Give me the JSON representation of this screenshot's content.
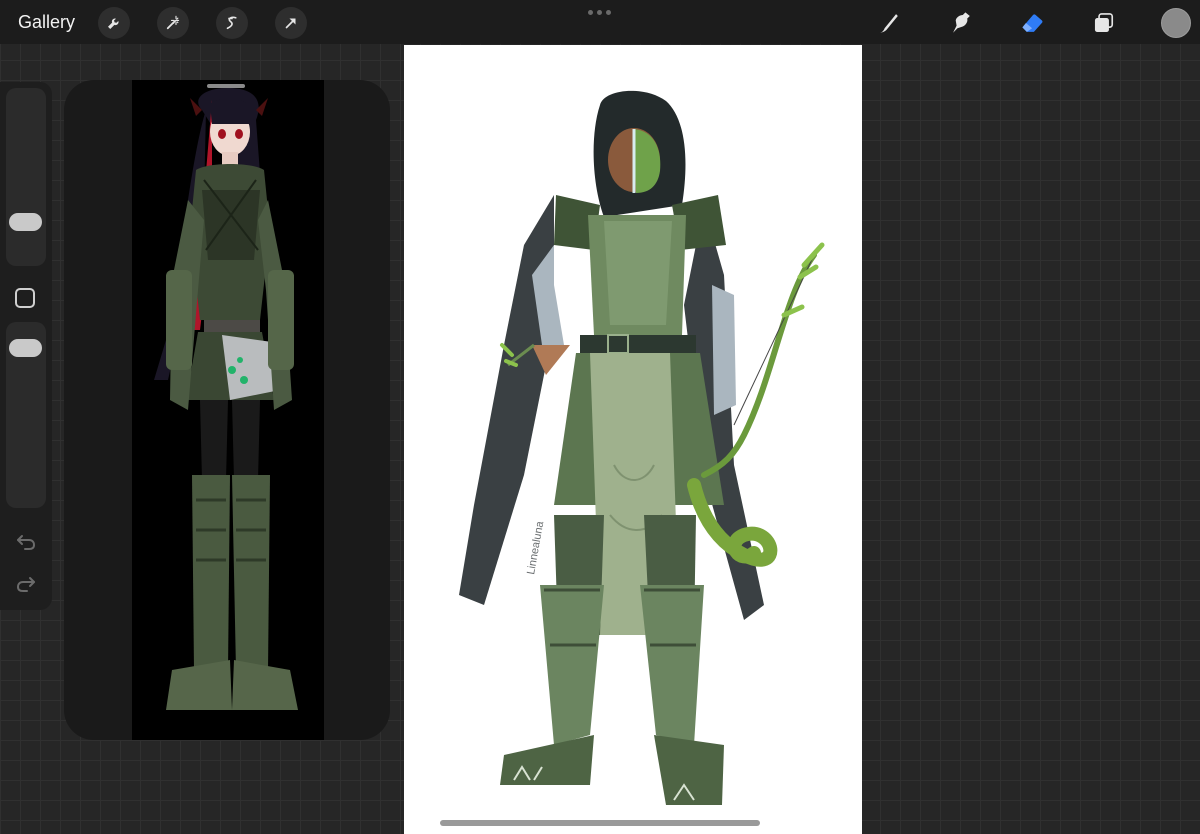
{
  "toolbar": {
    "gallery_label": "Gallery",
    "left_tools": [
      "wrench-icon",
      "magic-wand-icon",
      "selection-icon",
      "transform-arrow-icon"
    ],
    "right_tools": [
      "brush-icon",
      "smudge-icon",
      "eraser-icon",
      "layers-icon"
    ],
    "active_tool": "eraser-icon",
    "accent_color": "#2f7cf6",
    "current_color": "#8a8a8a"
  },
  "sidebar": {
    "brush_size_level": 0.38,
    "opacity_level": 0.12
  },
  "reference": {
    "background": "#000000"
  },
  "canvas": {
    "background": "#ffffff",
    "signature": "Linnealuna"
  }
}
